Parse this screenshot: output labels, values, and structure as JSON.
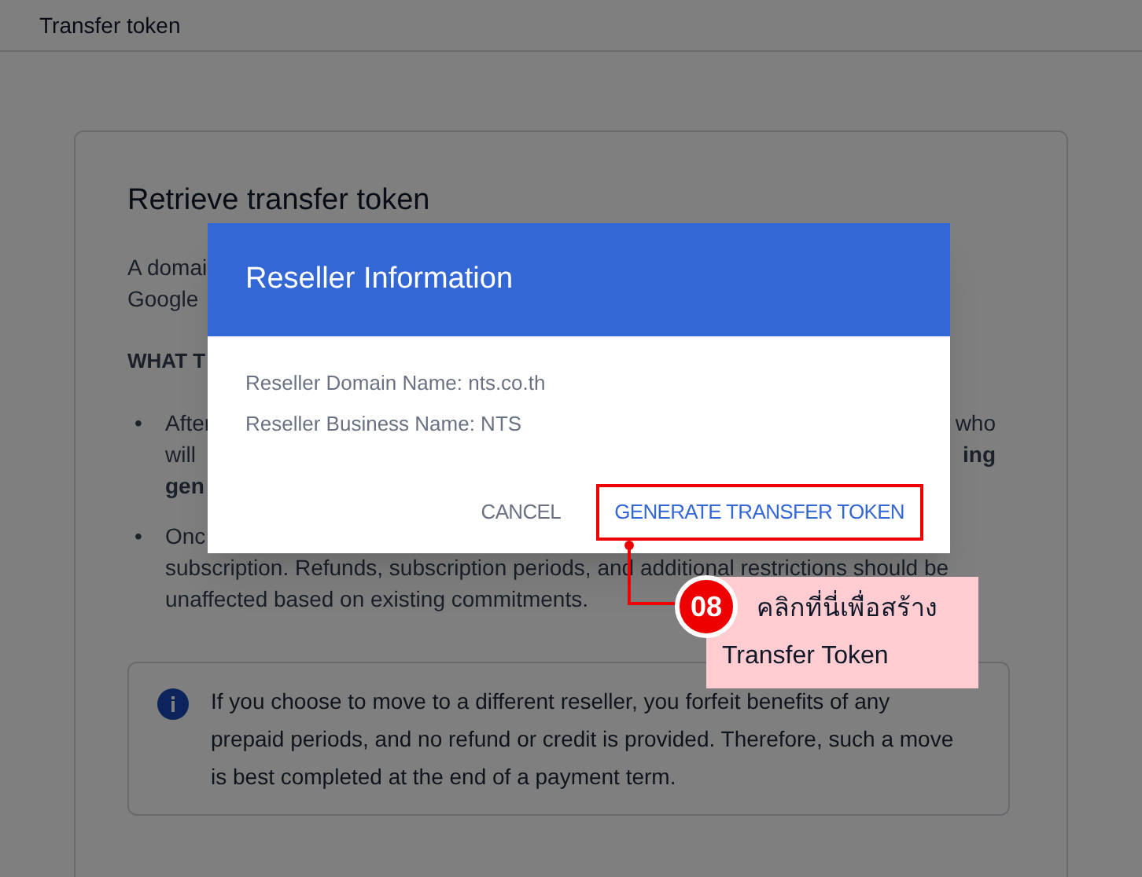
{
  "header": {
    "title": "Transfer token"
  },
  "card": {
    "title": "Retrieve transfer token",
    "intro_fragments": [
      "A domai",
      "Google"
    ],
    "section_heading": "WHAT T",
    "bullets": [
      {
        "marker": "•",
        "lines": [
          {
            "left": "After",
            "right": "who"
          },
          {
            "left": "will",
            "right": "ing",
            "bold_right": true
          },
          {
            "left": "gen",
            "bold_left": true
          }
        ]
      },
      {
        "marker": "•",
        "lines": [
          {
            "left": "Onc"
          },
          {
            "left": "subscription. Refunds, subscription periods, and additional restrictions should be"
          },
          {
            "left": "unaffected based on existing commitments."
          }
        ]
      }
    ],
    "info_note": "If you choose to move to a different reseller, you forfeit benefits of any prepaid periods, and no refund or credit is provided. Therefore, such a move is best completed at the end of a payment term."
  },
  "dialog": {
    "title": "Reseller Information",
    "lines": [
      "Reseller Domain Name: nts.co.th",
      "Reseller Business Name: NTS"
    ],
    "buttons": [
      {
        "label": "CANCEL",
        "kind": "secondary",
        "highlighted": false
      },
      {
        "label": "GENERATE TRANSFER TOKEN",
        "kind": "primary",
        "highlighted": true
      }
    ]
  },
  "callout": {
    "step": "08",
    "lines": [
      "คลิกที่นี่เพื่อสร้าง",
      "Transfer Token"
    ]
  }
}
